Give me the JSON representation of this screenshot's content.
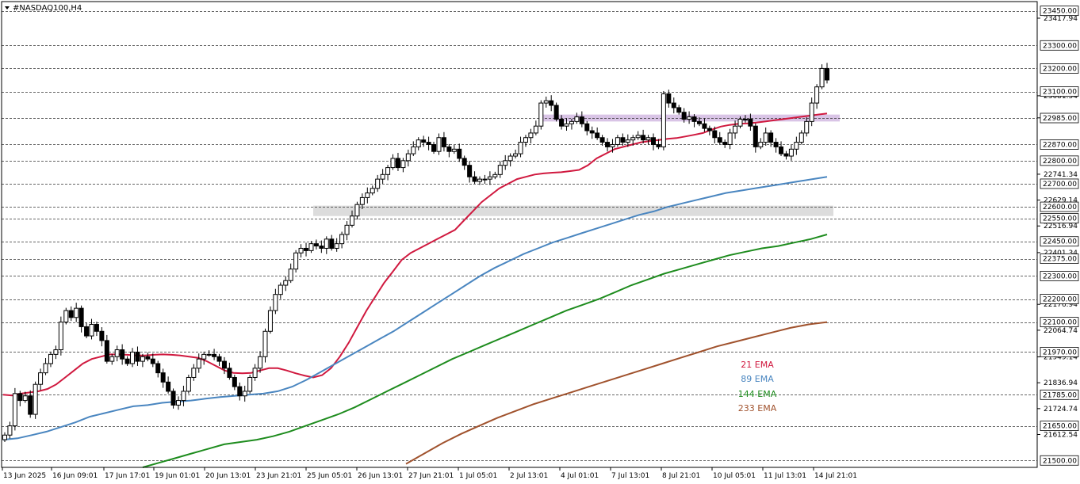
{
  "chart_data": {
    "type": "candlestick",
    "title": "#NASDAQ100,H4",
    "ylim": [
      21470,
      23490
    ],
    "y_ticks": [
      "23417.94",
      "23081.54",
      "22985.74",
      "22741.34",
      "22629.14",
      "22516.94",
      "22401.34",
      "22176.94",
      "22064.74",
      "21949.14",
      "21836.94",
      "21724.74",
      "21612.54"
    ],
    "levels": [
      {
        "value": 23450.0,
        "label": "23450.00"
      },
      {
        "value": 23300.0,
        "label": "23300.00"
      },
      {
        "value": 23200.0,
        "label": "23200.00"
      },
      {
        "value": 23100.0,
        "label": "23100.00"
      },
      {
        "value": 22985.0,
        "label": "22985.00"
      },
      {
        "value": 22870.0,
        "label": "22870.00"
      },
      {
        "value": 22800.0,
        "label": "22800.00"
      },
      {
        "value": 22700.0,
        "label": "22700.00"
      },
      {
        "value": 22600.0,
        "label": "22600.00"
      },
      {
        "value": 22550.0,
        "label": "22550.00"
      },
      {
        "value": 22450.0,
        "label": "22450.00"
      },
      {
        "value": 22375.0,
        "label": "22375.00"
      },
      {
        "value": 22300.0,
        "label": "22300.00"
      },
      {
        "value": 22200.0,
        "label": "22200.00"
      },
      {
        "value": 22100.0,
        "label": "22100.00"
      },
      {
        "value": 21970.0,
        "label": "21970.00"
      },
      {
        "value": 21785.0,
        "label": "21785.00"
      },
      {
        "value": 21650.0,
        "label": "21650.00"
      },
      {
        "value": 21500.0,
        "label": "21500.00"
      }
    ],
    "x_labels": [
      "13 Jun 2025",
      "16 Jun 09:01",
      "17 Jun 17:01",
      "19 Jun 01:01",
      "20 Jun 13:01",
      "23 Jun 21:01",
      "25 Jun 05:01",
      "26 Jun 13:01",
      "27 Jun 21:01",
      "1 Jul 05:01",
      "2 Jul 13:01",
      "4 Jul 01:01",
      "7 Jul 13:01",
      "8 Jul 21:01",
      "10 Jul 05:01",
      "11 Jul 13:01",
      "14 Jul 21:01"
    ],
    "zones": [
      {
        "name": "resistance-zone",
        "low": 22970,
        "high": 23000,
        "color": "#d9c4e6"
      },
      {
        "name": "support-zone",
        "low": 22560,
        "high": 22605,
        "color": "#dcdcdc"
      }
    ],
    "candles_close": [
      21610,
      21650,
      21790,
      21760,
      21780,
      21700,
      21830,
      21880,
      21920,
      21960,
      21980,
      22100,
      22150,
      22120,
      22160,
      22080,
      22040,
      22090,
      22060,
      22020,
      21930,
      21950,
      21980,
      21940,
      21920,
      21970,
      21930,
      21950,
      21940,
      21920,
      21880,
      21840,
      21800,
      21740,
      21760,
      21800,
      21860,
      21900,
      21940,
      21960,
      21960,
      21950,
      21930,
      21900,
      21860,
      21820,
      21780,
      21800,
      21860,
      21900,
      21950,
      22060,
      22150,
      22220,
      22260,
      22280,
      22330,
      22400,
      22420,
      22410,
      22440,
      22430,
      22420,
      22460,
      22420,
      22440,
      22480,
      22520,
      22560,
      22610,
      22640,
      22660,
      22680,
      22720,
      22740,
      22770,
      22810,
      22770,
      22800,
      22830,
      22860,
      22890,
      22880,
      22870,
      22840,
      22900,
      22860,
      22840,
      22850,
      22810,
      22780,
      22730,
      22710,
      22720,
      22720,
      22730,
      22740,
      22780,
      22800,
      22820,
      22830,
      22880,
      22900,
      22920,
      22950,
      23050,
      23060,
      23040,
      22980,
      22950,
      22960,
      22970,
      22990,
      22960,
      22930,
      22920,
      22900,
      22880,
      22860,
      22870,
      22900,
      22880,
      22890,
      22900,
      22910,
      22890,
      22900,
      22870,
      22860,
      23090,
      23050,
      23030,
      23010,
      22980,
      22990,
      22970,
      22960,
      22940,
      22930,
      22900,
      22880,
      22870,
      22920,
      22950,
      22980,
      22980,
      22950,
      22860,
      22880,
      22920,
      22880,
      22860,
      22830,
      22820,
      22850,
      22880,
      22920,
      22970,
      23050,
      23120,
      23200,
      23150
    ],
    "series": [
      {
        "name": "21 EMA",
        "color": "#d0193f",
        "values": [
          21785,
          21782,
          21790,
          21795,
          21800,
          21810,
          21830,
          21860,
          21890,
          21920,
          21940,
          21950,
          21960,
          21960,
          21958,
          21955,
          21955,
          21958,
          21960,
          21958,
          21955,
          21950,
          21945,
          21930,
          21910,
          21890,
          21880,
          21878,
          21880,
          21890,
          21900,
          21900,
          21890,
          21878,
          21868,
          21860,
          21870,
          21900,
          21950,
          22010,
          22080,
          22150,
          22210,
          22270,
          22320,
          22370,
          22400,
          22420,
          22440,
          22460,
          22480,
          22500,
          22540,
          22580,
          22620,
          22650,
          22680,
          22700,
          22720,
          22730,
          22740,
          22745,
          22748,
          22750,
          22755,
          22760,
          22780,
          22810,
          22830,
          22850,
          22860,
          22870,
          22880,
          22885,
          22890,
          22895,
          22898,
          22905,
          22912,
          22920,
          22935,
          22948,
          22955,
          22960,
          22962,
          22965,
          22970,
          22975,
          22980,
          22985,
          22990,
          22995,
          23000,
          23005
        ]
      },
      {
        "name": "89 EMA",
        "color": "#4a86c0",
        "values": [
          21590,
          21596,
          21610,
          21625,
          21645,
          21665,
          21690,
          21705,
          21720,
          21735,
          21740,
          21750,
          21755,
          21760,
          21768,
          21775,
          21780,
          21785,
          21790,
          21800,
          21820,
          21850,
          21885,
          21920,
          21955,
          21990,
          22025,
          22060,
          22100,
          22140,
          22180,
          22220,
          22260,
          22300,
          22335,
          22365,
          22395,
          22420,
          22445,
          22465,
          22485,
          22505,
          22525,
          22545,
          22565,
          22580,
          22600,
          22615,
          22630,
          22645,
          22660,
          22670,
          22680,
          22690,
          22700,
          22710,
          22720,
          22730
        ]
      },
      {
        "name": "144 EMA",
        "color": "#1e8c1e",
        "values": [
          21470,
          21490,
          21510,
          21530,
          21550,
          21570,
          21580,
          21590,
          21605,
          21625,
          21650,
          21675,
          21700,
          21730,
          21765,
          21800,
          21835,
          21870,
          21905,
          21940,
          21970,
          22000,
          22030,
          22060,
          22090,
          22120,
          22150,
          22175,
          22200,
          22230,
          22260,
          22285,
          22310,
          22330,
          22350,
          22370,
          22390,
          22405,
          22420,
          22430,
          22445,
          22460,
          22480
        ]
      },
      {
        "name": "233 EMA",
        "color": "#a0522d",
        "values": [
          21485,
          21530,
          21575,
          21615,
          21650,
          21685,
          21715,
          21745,
          21770,
          21795,
          21820,
          21845,
          21870,
          21895,
          21920,
          21945,
          21970,
          21995,
          22015,
          22035,
          22055,
          22075,
          22090,
          22100
        ]
      }
    ]
  }
}
